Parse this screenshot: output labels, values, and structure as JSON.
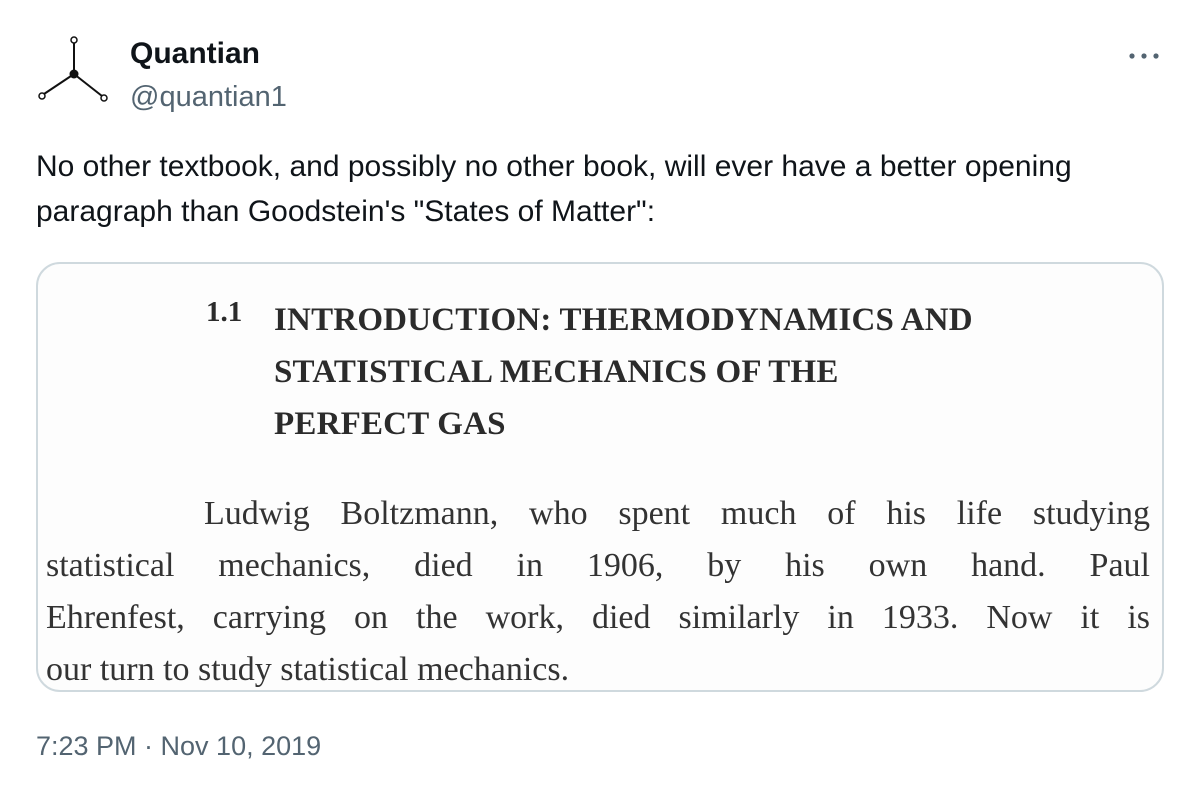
{
  "author": {
    "display_name": "Quantian",
    "handle": "@quantian1",
    "avatar_icon": "molecule-diagram-icon"
  },
  "tweet": {
    "text": "No other textbook, and possibly no other book, will ever have a better opening paragraph than Goodstein's \"States of Matter\":",
    "timestamp": "7:23 PM · Nov 10, 2019"
  },
  "more_icon": "more-horizontal-icon",
  "media": {
    "section_number": "1.1",
    "heading_lines": [
      "INTRODUCTION: THERMODYNAMICS AND",
      "STATISTICAL MECHANICS OF THE",
      "PERFECT GAS"
    ],
    "paragraph_lines": [
      "Ludwig Boltzmann, who spent much of his life studying",
      "statistical mechanics, died in 1906, by his own hand. Paul",
      "Ehrenfest, carrying on the work, died similarly in 1933. Now it is",
      "our turn to study statistical mechanics."
    ]
  },
  "colors": {
    "text": "#0f1419",
    "secondary_text": "#536471",
    "card_border": "#cfd9de"
  }
}
